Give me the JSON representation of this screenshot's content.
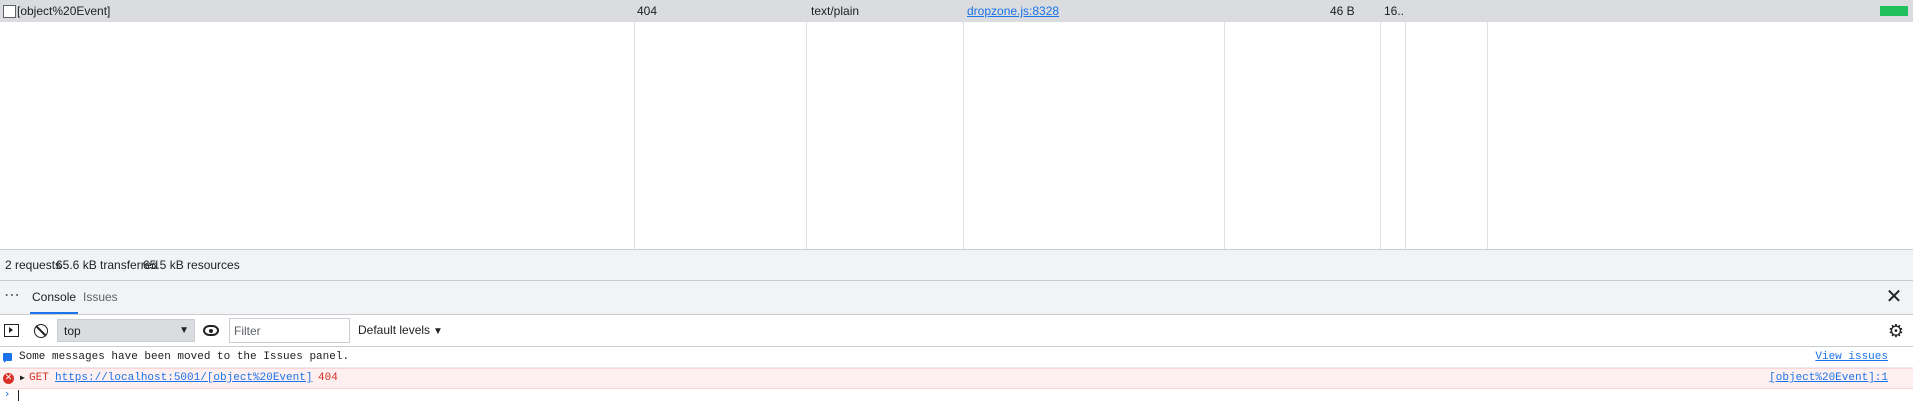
{
  "network": {
    "row": {
      "name": "[object%20Event]",
      "status": "404",
      "type": "text/plain",
      "initiator": "dropzone.js:8328",
      "size": "46 B",
      "time": "16..."
    },
    "waterfall_color": "#20c05c"
  },
  "summary": {
    "requests": "2 requests",
    "transferred": "65.6 kB transferred",
    "resources": "65.5 kB resources"
  },
  "drawer": {
    "more": "⋯",
    "tabs": [
      {
        "label": "Console",
        "active": true
      },
      {
        "label": "Issues",
        "active": false
      }
    ],
    "close": "✕"
  },
  "toolbar": {
    "context": "top",
    "context_arrow": "▼",
    "filter_placeholder": "Filter",
    "levels": "Default levels",
    "levels_arrow": "▼",
    "settings": "⚙"
  },
  "console": {
    "info_message": "Some messages have been moved to the Issues panel.",
    "info_link": "View issues",
    "error": {
      "icon": "✕",
      "expand": "▶",
      "method": "GET",
      "url": "https://localhost:5001/[object%20Event]",
      "status": "404",
      "source": "[object%20Event]:1"
    },
    "prompt": "›"
  },
  "colors": {
    "accent": "#1a73e8",
    "error": "#d93025",
    "error_bg": "#fef0f0",
    "selected_row": "#dadce0"
  }
}
